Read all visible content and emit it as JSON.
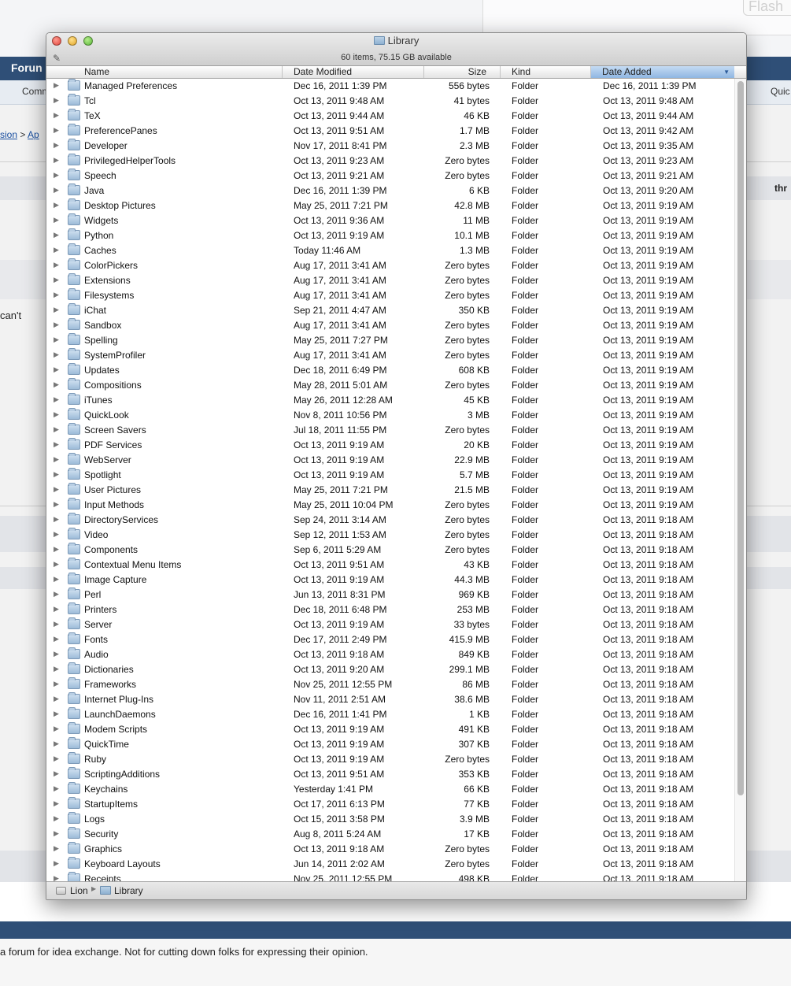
{
  "background": {
    "flash_button": "Flash",
    "forum_label": "Forun",
    "community_label": "Comm",
    "quick_label": "Quic",
    "breadcrumb_a": "sion",
    "breadcrumb_sep": ">",
    "breadcrumb_b": "Ap",
    "thread_label": "thr",
    "snippet": "can't",
    "footer_text": "a forum for idea exchange. Not for cutting down folks for expressing their opinion."
  },
  "window": {
    "title": "Library",
    "status": "60 items, 75.15 GB available",
    "columns": {
      "name": "Name",
      "date_modified": "Date Modified",
      "size": "Size",
      "kind": "Kind",
      "date_added": "Date Added"
    },
    "sorted_column": "Date Added",
    "rows": [
      {
        "name": "Managed Preferences",
        "modified": "Dec 16, 2011 1:39 PM",
        "size": "556 bytes",
        "kind": "Folder",
        "added": "Dec 16, 2011 1:39 PM"
      },
      {
        "name": "Tcl",
        "modified": "Oct 13, 2011 9:48 AM",
        "size": "41 bytes",
        "kind": "Folder",
        "added": "Oct 13, 2011 9:48 AM"
      },
      {
        "name": "TeX",
        "modified": "Oct 13, 2011 9:44 AM",
        "size": "46 KB",
        "kind": "Folder",
        "added": "Oct 13, 2011 9:44 AM"
      },
      {
        "name": "PreferencePanes",
        "modified": "Oct 13, 2011 9:51 AM",
        "size": "1.7 MB",
        "kind": "Folder",
        "added": "Oct 13, 2011 9:42 AM"
      },
      {
        "name": "Developer",
        "modified": "Nov 17, 2011 8:41 PM",
        "size": "2.3 MB",
        "kind": "Folder",
        "added": "Oct 13, 2011 9:35 AM"
      },
      {
        "name": "PrivilegedHelperTools",
        "modified": "Oct 13, 2011 9:23 AM",
        "size": "Zero bytes",
        "kind": "Folder",
        "added": "Oct 13, 2011 9:23 AM"
      },
      {
        "name": "Speech",
        "modified": "Oct 13, 2011 9:21 AM",
        "size": "Zero bytes",
        "kind": "Folder",
        "added": "Oct 13, 2011 9:21 AM"
      },
      {
        "name": "Java",
        "modified": "Dec 16, 2011 1:39 PM",
        "size": "6 KB",
        "kind": "Folder",
        "added": "Oct 13, 2011 9:20 AM"
      },
      {
        "name": "Desktop Pictures",
        "modified": "May 25, 2011 7:21 PM",
        "size": "42.8 MB",
        "kind": "Folder",
        "added": "Oct 13, 2011 9:19 AM"
      },
      {
        "name": "Widgets",
        "modified": "Oct 13, 2011 9:36 AM",
        "size": "11 MB",
        "kind": "Folder",
        "added": "Oct 13, 2011 9:19 AM"
      },
      {
        "name": "Python",
        "modified": "Oct 13, 2011 9:19 AM",
        "size": "10.1 MB",
        "kind": "Folder",
        "added": "Oct 13, 2011 9:19 AM"
      },
      {
        "name": "Caches",
        "modified": "Today 11:46 AM",
        "size": "1.3 MB",
        "kind": "Folder",
        "added": "Oct 13, 2011 9:19 AM"
      },
      {
        "name": "ColorPickers",
        "modified": "Aug 17, 2011 3:41 AM",
        "size": "Zero bytes",
        "kind": "Folder",
        "added": "Oct 13, 2011 9:19 AM"
      },
      {
        "name": "Extensions",
        "modified": "Aug 17, 2011 3:41 AM",
        "size": "Zero bytes",
        "kind": "Folder",
        "added": "Oct 13, 2011 9:19 AM"
      },
      {
        "name": "Filesystems",
        "modified": "Aug 17, 2011 3:41 AM",
        "size": "Zero bytes",
        "kind": "Folder",
        "added": "Oct 13, 2011 9:19 AM"
      },
      {
        "name": "iChat",
        "modified": "Sep 21, 2011 4:47 AM",
        "size": "350 KB",
        "kind": "Folder",
        "added": "Oct 13, 2011 9:19 AM"
      },
      {
        "name": "Sandbox",
        "modified": "Aug 17, 2011 3:41 AM",
        "size": "Zero bytes",
        "kind": "Folder",
        "added": "Oct 13, 2011 9:19 AM"
      },
      {
        "name": "Spelling",
        "modified": "May 25, 2011 7:27 PM",
        "size": "Zero bytes",
        "kind": "Folder",
        "added": "Oct 13, 2011 9:19 AM"
      },
      {
        "name": "SystemProfiler",
        "modified": "Aug 17, 2011 3:41 AM",
        "size": "Zero bytes",
        "kind": "Folder",
        "added": "Oct 13, 2011 9:19 AM"
      },
      {
        "name": "Updates",
        "modified": "Dec 18, 2011 6:49 PM",
        "size": "608 KB",
        "kind": "Folder",
        "added": "Oct 13, 2011 9:19 AM"
      },
      {
        "name": "Compositions",
        "modified": "May 28, 2011 5:01 AM",
        "size": "Zero bytes",
        "kind": "Folder",
        "added": "Oct 13, 2011 9:19 AM"
      },
      {
        "name": "iTunes",
        "modified": "May 26, 2011 12:28 AM",
        "size": "45 KB",
        "kind": "Folder",
        "added": "Oct 13, 2011 9:19 AM"
      },
      {
        "name": "QuickLook",
        "modified": "Nov 8, 2011 10:56 PM",
        "size": "3 MB",
        "kind": "Folder",
        "added": "Oct 13, 2011 9:19 AM"
      },
      {
        "name": "Screen Savers",
        "modified": "Jul 18, 2011 11:55 PM",
        "size": "Zero bytes",
        "kind": "Folder",
        "added": "Oct 13, 2011 9:19 AM"
      },
      {
        "name": "PDF Services",
        "modified": "Oct 13, 2011 9:19 AM",
        "size": "20 KB",
        "kind": "Folder",
        "added": "Oct 13, 2011 9:19 AM"
      },
      {
        "name": "WebServer",
        "modified": "Oct 13, 2011 9:19 AM",
        "size": "22.9 MB",
        "kind": "Folder",
        "added": "Oct 13, 2011 9:19 AM"
      },
      {
        "name": "Spotlight",
        "modified": "Oct 13, 2011 9:19 AM",
        "size": "5.7 MB",
        "kind": "Folder",
        "added": "Oct 13, 2011 9:19 AM"
      },
      {
        "name": "User Pictures",
        "modified": "May 25, 2011 7:21 PM",
        "size": "21.5 MB",
        "kind": "Folder",
        "added": "Oct 13, 2011 9:19 AM"
      },
      {
        "name": "Input Methods",
        "modified": "May 25, 2011 10:04 PM",
        "size": "Zero bytes",
        "kind": "Folder",
        "added": "Oct 13, 2011 9:19 AM"
      },
      {
        "name": "DirectoryServices",
        "modified": "Sep 24, 2011 3:14 AM",
        "size": "Zero bytes",
        "kind": "Folder",
        "added": "Oct 13, 2011 9:18 AM"
      },
      {
        "name": "Video",
        "modified": "Sep 12, 2011 1:53 AM",
        "size": "Zero bytes",
        "kind": "Folder",
        "added": "Oct 13, 2011 9:18 AM"
      },
      {
        "name": "Components",
        "modified": "Sep 6, 2011 5:29 AM",
        "size": "Zero bytes",
        "kind": "Folder",
        "added": "Oct 13, 2011 9:18 AM"
      },
      {
        "name": "Contextual Menu Items",
        "modified": "Oct 13, 2011 9:51 AM",
        "size": "43 KB",
        "kind": "Folder",
        "added": "Oct 13, 2011 9:18 AM"
      },
      {
        "name": "Image Capture",
        "modified": "Oct 13, 2011 9:19 AM",
        "size": "44.3 MB",
        "kind": "Folder",
        "added": "Oct 13, 2011 9:18 AM"
      },
      {
        "name": "Perl",
        "modified": "Jun 13, 2011 8:31 PM",
        "size": "969 KB",
        "kind": "Folder",
        "added": "Oct 13, 2011 9:18 AM"
      },
      {
        "name": "Printers",
        "modified": "Dec 18, 2011 6:48 PM",
        "size": "253 MB",
        "kind": "Folder",
        "added": "Oct 13, 2011 9:18 AM"
      },
      {
        "name": "Server",
        "modified": "Oct 13, 2011 9:19 AM",
        "size": "33 bytes",
        "kind": "Folder",
        "added": "Oct 13, 2011 9:18 AM"
      },
      {
        "name": "Fonts",
        "modified": "Dec 17, 2011 2:49 PM",
        "size": "415.9 MB",
        "kind": "Folder",
        "added": "Oct 13, 2011 9:18 AM"
      },
      {
        "name": "Audio",
        "modified": "Oct 13, 2011 9:18 AM",
        "size": "849 KB",
        "kind": "Folder",
        "added": "Oct 13, 2011 9:18 AM"
      },
      {
        "name": "Dictionaries",
        "modified": "Oct 13, 2011 9:20 AM",
        "size": "299.1 MB",
        "kind": "Folder",
        "added": "Oct 13, 2011 9:18 AM"
      },
      {
        "name": "Frameworks",
        "modified": "Nov 25, 2011 12:55 PM",
        "size": "86 MB",
        "kind": "Folder",
        "added": "Oct 13, 2011 9:18 AM"
      },
      {
        "name": "Internet Plug-Ins",
        "modified": "Nov 11, 2011 2:51 AM",
        "size": "38.6 MB",
        "kind": "Folder",
        "added": "Oct 13, 2011 9:18 AM"
      },
      {
        "name": "LaunchDaemons",
        "modified": "Dec 16, 2011 1:41 PM",
        "size": "1 KB",
        "kind": "Folder",
        "added": "Oct 13, 2011 9:18 AM"
      },
      {
        "name": "Modem Scripts",
        "modified": "Oct 13, 2011 9:19 AM",
        "size": "491 KB",
        "kind": "Folder",
        "added": "Oct 13, 2011 9:18 AM"
      },
      {
        "name": "QuickTime",
        "modified": "Oct 13, 2011 9:19 AM",
        "size": "307 KB",
        "kind": "Folder",
        "added": "Oct 13, 2011 9:18 AM"
      },
      {
        "name": "Ruby",
        "modified": "Oct 13, 2011 9:19 AM",
        "size": "Zero bytes",
        "kind": "Folder",
        "added": "Oct 13, 2011 9:18 AM"
      },
      {
        "name": "ScriptingAdditions",
        "modified": "Oct 13, 2011 9:51 AM",
        "size": "353 KB",
        "kind": "Folder",
        "added": "Oct 13, 2011 9:18 AM"
      },
      {
        "name": "Keychains",
        "modified": "Yesterday 1:41 PM",
        "size": "66 KB",
        "kind": "Folder",
        "added": "Oct 13, 2011 9:18 AM"
      },
      {
        "name": "StartupItems",
        "modified": "Oct 17, 2011 6:13 PM",
        "size": "77 KB",
        "kind": "Folder",
        "added": "Oct 13, 2011 9:18 AM"
      },
      {
        "name": "Logs",
        "modified": "Oct 15, 2011 3:58 PM",
        "size": "3.9 MB",
        "kind": "Folder",
        "added": "Oct 13, 2011 9:18 AM"
      },
      {
        "name": "Security",
        "modified": "Aug 8, 2011 5:24 AM",
        "size": "17 KB",
        "kind": "Folder",
        "added": "Oct 13, 2011 9:18 AM"
      },
      {
        "name": "Graphics",
        "modified": "Oct 13, 2011 9:18 AM",
        "size": "Zero bytes",
        "kind": "Folder",
        "added": "Oct 13, 2011 9:18 AM"
      },
      {
        "name": "Keyboard Layouts",
        "modified": "Jun 14, 2011 2:02 AM",
        "size": "Zero bytes",
        "kind": "Folder",
        "added": "Oct 13, 2011 9:18 AM"
      },
      {
        "name": "Receipts",
        "modified": "Nov 25, 2011 12:55 PM",
        "size": "498 KB",
        "kind": "Folder",
        "added": "Oct 13, 2011 9:18 AM"
      }
    ],
    "path_bar": {
      "volume": "Lion",
      "folder": "Library"
    }
  },
  "colors": {
    "forum_bar": "#2f4f77",
    "sorted_header": "#a9c8ec"
  }
}
